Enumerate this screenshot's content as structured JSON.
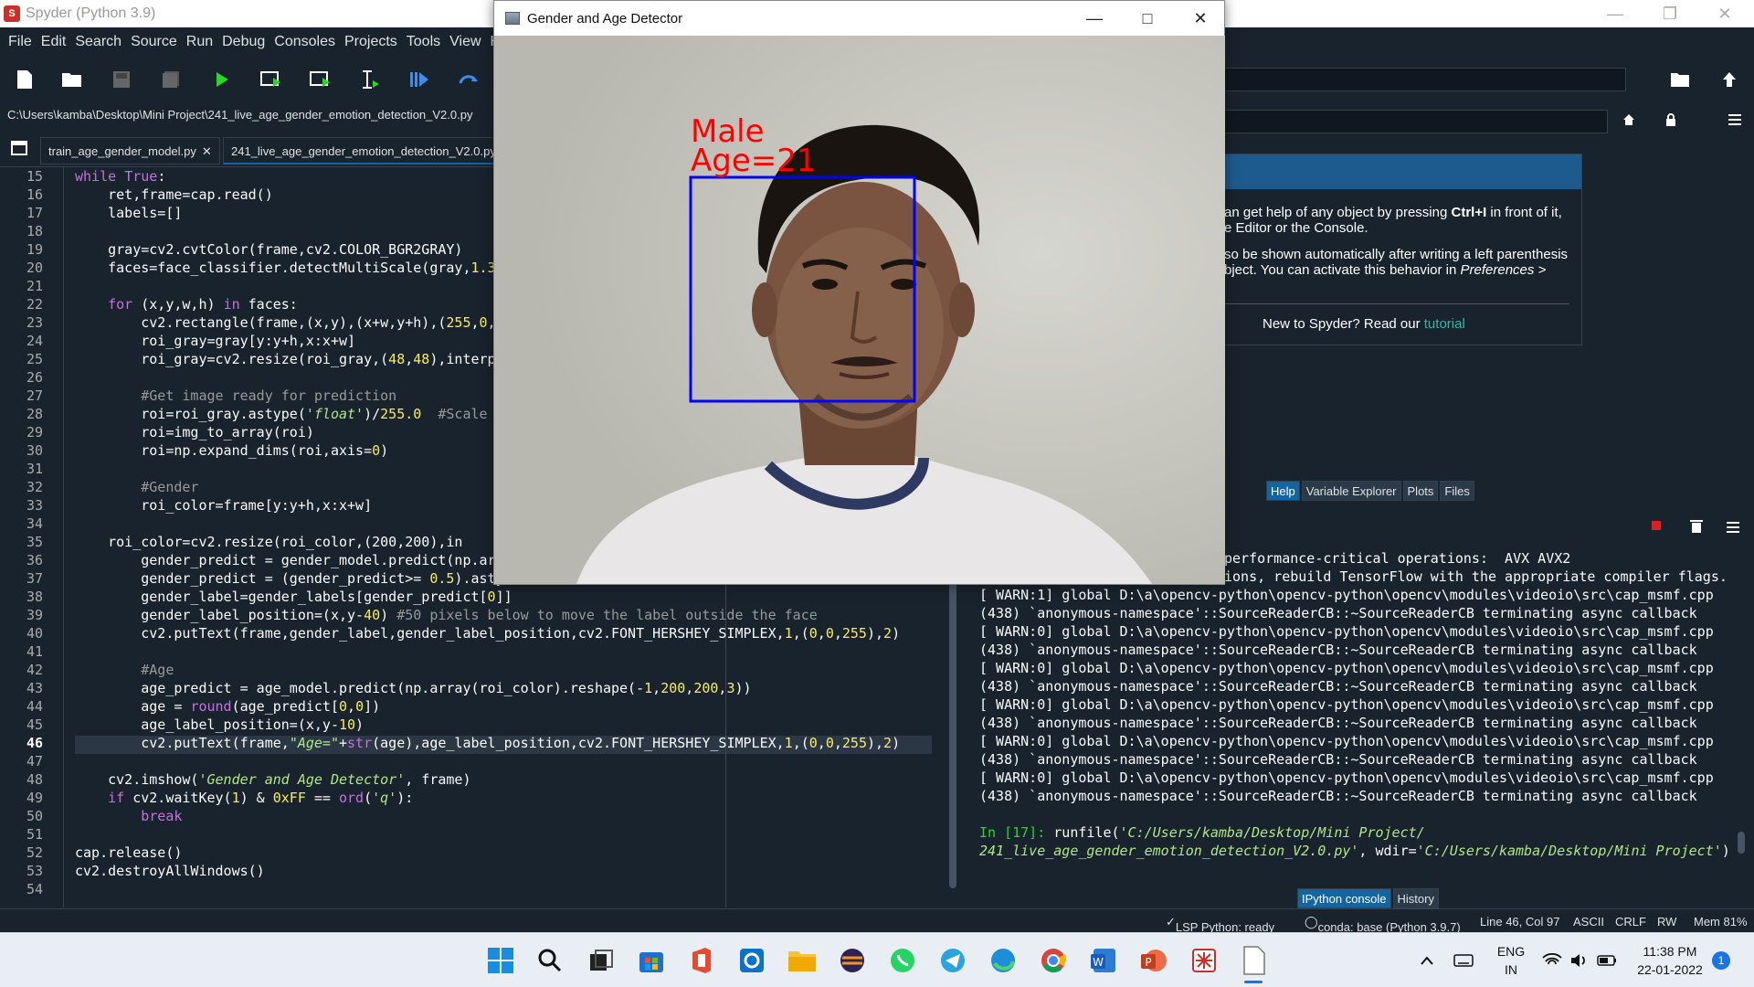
{
  "app_title": "Spyder (Python 3.9)",
  "menu": [
    "File",
    "Edit",
    "Search",
    "Source",
    "Run",
    "Debug",
    "Consoles",
    "Projects",
    "Tools",
    "View",
    "Help"
  ],
  "file_path": "C:\\Users\\kamba\\Desktop\\Mini Project\\241_live_age_gender_emotion_detection_V2.0.py",
  "tabs": [
    {
      "label": "train_age_gender_model.py"
    },
    {
      "label": "241_live_age_gender_emotion_detection_V2.0.py"
    }
  ],
  "editor": {
    "line_numbers": [
      "15",
      "16",
      "17",
      "18",
      "19",
      "20",
      "21",
      "22",
      "23",
      "24",
      "25",
      "26",
      "27",
      "28",
      "29",
      "30",
      "31",
      "32",
      "33",
      "34",
      "35",
      "36",
      "37",
      "38",
      "39",
      "40",
      "41",
      "42",
      "43",
      "44",
      "45",
      "46",
      "47",
      "48",
      "49",
      "50",
      "51",
      "52",
      "53",
      "54"
    ],
    "current_line": "46",
    "code": {
      "l40": "    roi_color=cv2.resize(roi_color,(200,200),in"
    }
  },
  "help": {
    "line1a": "an get help of any object by pressing ",
    "line1b": "Ctrl+I",
    "line1c": " in front of it,",
    "line2": "e Editor or the Console.",
    "line3": "so be shown automatically after writing a left parenthesis",
    "line4a": "bject. You can activate this behavior in ",
    "line4b": "Preferences >",
    "new_prefix": "New to Spyder? Read our ",
    "new_link": "tutorial"
  },
  "pane_tabs": [
    "Help",
    "Variable Explorer",
    "Plots",
    "Files"
  ],
  "console": {
    "lines": [
      "performance-critical operations:  AVX AVX2",
      "ions, rebuild TensorFlow with the appropriate compiler flags.",
      "[ WARN:1] global D:\\a\\opencv-python\\opencv-python\\opencv\\modules\\videoio\\src\\cap_msmf.cpp",
      "(438) `anonymous-namespace'::SourceReaderCB::~SourceReaderCB terminating async callback",
      "[ WARN:0] global D:\\a\\opencv-python\\opencv-python\\opencv\\modules\\videoio\\src\\cap_msmf.cpp",
      "(438) `anonymous-namespace'::SourceReaderCB::~SourceReaderCB terminating async callback",
      "[ WARN:0] global D:\\a\\opencv-python\\opencv-python\\opencv\\modules\\videoio\\src\\cap_msmf.cpp",
      "(438) `anonymous-namespace'::SourceReaderCB::~SourceReaderCB terminating async callback",
      "[ WARN:0] global D:\\a\\opencv-python\\opencv-python\\opencv\\modules\\videoio\\src\\cap_msmf.cpp",
      "(438) `anonymous-namespace'::SourceReaderCB::~SourceReaderCB terminating async callback",
      "[ WARN:0] global D:\\a\\opencv-python\\opencv-python\\opencv\\modules\\videoio\\src\\cap_msmf.cpp",
      "(438) `anonymous-namespace'::SourceReaderCB::~SourceReaderCB terminating async callback",
      "[ WARN:0] global D:\\a\\opencv-python\\opencv-python\\opencv\\modules\\videoio\\src\\cap_msmf.cpp",
      "(438) `anonymous-namespace'::SourceReaderCB::~SourceReaderCB terminating async callback"
    ],
    "prompt": "In [17]:",
    "cmd1a": " runfile(",
    "cmd1b": "'C:/Users/kamba/Desktop/Mini Project/",
    "cmd2a": "241_live_age_gender_emotion_detection_V2.0.py'",
    "cmd2b": ", wdir=",
    "cmd2c": "'C:/Users/kamba/Desktop/Mini Project'",
    "cmd2d": ")"
  },
  "console_tabs": [
    "IPython console",
    "History"
  ],
  "status": {
    "lsp": "LSP Python: ready",
    "conda": "conda: base (Python 3.9.7)",
    "position": "Line 46, Col 97",
    "encoding": "ASCII",
    "eol": "CRLF",
    "rw": "RW",
    "mem": "Mem 81%"
  },
  "cv_window": {
    "title": "Gender and Age Detector",
    "gender_label": "Male",
    "age_label": "Age=21",
    "box_color": "#0000ff",
    "text_color": "#ff0000"
  },
  "taskbar": {
    "lang1": "ENG",
    "lang2": "IN",
    "time": "11:38 PM",
    "date": "22-01-2022",
    "badge": "1"
  },
  "colors": {
    "bg": "#19232d",
    "accent": "#1464a0",
    "keyword": "#c670e0",
    "string": "#b0e686",
    "number": "#faed5c"
  }
}
